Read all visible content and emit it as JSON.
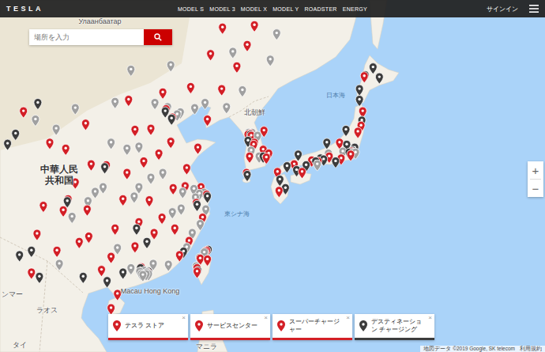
{
  "header": {
    "logo": "TESLA",
    "nav": [
      "MODEL S",
      "MODEL 3",
      "MODEL X",
      "MODEL Y",
      "ROADSTER",
      "ENERGY"
    ],
    "signin": "サインイン"
  },
  "search": {
    "placeholder": "場所を入力"
  },
  "zoom": {
    "in": "+",
    "out": "−"
  },
  "legend": [
    {
      "label": "テスラ ストア",
      "color": "#d31f26",
      "active": true,
      "close": "×"
    },
    {
      "label": "サービスセンター",
      "color": "#d31f26",
      "active": true,
      "close": "×"
    },
    {
      "label": "スーパーチャージャー",
      "color": "#d31f26",
      "active": true,
      "close": "×"
    },
    {
      "label": "デスティネーション チャージング",
      "color": "#3c3c3c",
      "active": true,
      "close": "×"
    }
  ],
  "attribution": {
    "data": "地図データ ©2019 Google, SK telecom",
    "terms": "利用規約"
  },
  "map": {
    "labels": [
      {
        "text": "Улаанбаатар",
        "lon": 108.1,
        "lat": 48.4,
        "kind": "place"
      },
      {
        "text": "中華人民共和国",
        "lon": 103.0,
        "lat": 33.9,
        "kind": "country"
      },
      {
        "text": "北朝鮮",
        "lon": 127.5,
        "lat": 40.2,
        "kind": "place"
      },
      {
        "text": "日本海",
        "lon": 137.7,
        "lat": 41.9,
        "kind": "sea"
      },
      {
        "text": "東シナ海",
        "lon": 125.3,
        "lat": 29.9,
        "kind": "sea"
      },
      {
        "text": "Macau Hong Kong",
        "lon": 114.4,
        "lat": 21.1,
        "kind": "place"
      },
      {
        "text": "ラオス",
        "lon": 101.5,
        "lat": 18.9,
        "kind": "place"
      },
      {
        "text": "ンマー",
        "lon": 97.1,
        "lat": 20.7,
        "kind": "place"
      },
      {
        "text": "タイ",
        "lon": 98.0,
        "lat": 14.7,
        "kind": "place"
      },
      {
        "text": "マニラ",
        "lon": 121.5,
        "lat": 14.5,
        "kind": "place"
      }
    ],
    "pins": [
      {
        "lon": 116.4,
        "lat": 39.9,
        "color": "#d31f26"
      },
      {
        "lon": 117.2,
        "lat": 39.1,
        "color": "#d31f26"
      },
      {
        "lon": 121.5,
        "lat": 31.2,
        "color": "#d31f26"
      },
      {
        "lon": 120.2,
        "lat": 30.3,
        "color": "#d31f26"
      },
      {
        "lon": 118.8,
        "lat": 32.1,
        "color": "#d31f26"
      },
      {
        "lon": 114.3,
        "lat": 30.6,
        "color": "#d31f26"
      },
      {
        "lon": 113.0,
        "lat": 28.2,
        "color": "#d31f26"
      },
      {
        "lon": 113.3,
        "lat": 23.1,
        "color": "#d31f26"
      },
      {
        "lon": 114.1,
        "lat": 22.5,
        "color": "#d31f26"
      },
      {
        "lon": 118.1,
        "lat": 24.5,
        "color": "#d31f26"
      },
      {
        "lon": 119.3,
        "lat": 26.1,
        "color": "#d31f26"
      },
      {
        "lon": 104.1,
        "lat": 30.7,
        "color": "#d31f26"
      },
      {
        "lon": 106.5,
        "lat": 29.6,
        "color": "#d31f26"
      },
      {
        "lon": 108.9,
        "lat": 34.3,
        "color": "#d31f26"
      },
      {
        "lon": 113.6,
        "lat": 34.7,
        "color": "#d31f26"
      },
      {
        "lon": 117.0,
        "lat": 36.7,
        "color": "#d31f26"
      },
      {
        "lon": 120.4,
        "lat": 36.1,
        "color": "#d31f26"
      },
      {
        "lon": 123.4,
        "lat": 41.8,
        "color": "#d31f26"
      },
      {
        "lon": 121.6,
        "lat": 38.9,
        "color": "#d31f26"
      },
      {
        "lon": 126.6,
        "lat": 45.8,
        "color": "#d31f26"
      },
      {
        "lon": 125.3,
        "lat": 43.9,
        "color": "#d31f26"
      },
      {
        "lon": 111.7,
        "lat": 40.8,
        "color": "#d31f26"
      },
      {
        "lon": 112.5,
        "lat": 37.9,
        "color": "#d31f26"
      },
      {
        "lon": 114.5,
        "lat": 38.0,
        "color": "#d31f26"
      },
      {
        "lon": 117.3,
        "lat": 31.9,
        "color": "#d31f26"
      },
      {
        "lon": 115.9,
        "lat": 28.7,
        "color": "#d31f26"
      },
      {
        "lon": 102.7,
        "lat": 25.0,
        "color": "#d31f26"
      },
      {
        "lon": 106.7,
        "lat": 26.6,
        "color": "#d31f26"
      },
      {
        "lon": 108.3,
        "lat": 22.8,
        "color": "#d31f26"
      },
      {
        "lon": 110.3,
        "lat": 20.0,
        "color": "#d31f26"
      },
      {
        "lon": 103.8,
        "lat": 36.0,
        "color": "#d31f26"
      },
      {
        "lon": 101.8,
        "lat": 36.6,
        "color": "#d31f26"
      },
      {
        "lon": 106.3,
        "lat": 38.5,
        "color": "#d31f26"
      },
      {
        "lon": 98.5,
        "lat": 39.7,
        "color": "#d31f26"
      },
      {
        "lon": 109.5,
        "lat": 18.3,
        "color": "#d31f26"
      },
      {
        "lon": 100.2,
        "lat": 26.9,
        "color": "#d31f26"
      },
      {
        "lon": 105.0,
        "lat": 32.5,
        "color": "#d31f26"
      },
      {
        "lon": 110.0,
        "lat": 27.5,
        "color": "#d31f26"
      },
      {
        "lon": 111.5,
        "lat": 33.5,
        "color": "#d31f26"
      },
      {
        "lon": 119.5,
        "lat": 42.0,
        "color": "#d31f26"
      },
      {
        "lon": 116.0,
        "lat": 41.5,
        "color": "#d31f26"
      },
      {
        "lon": 122.0,
        "lat": 45.0,
        "color": "#d31f26"
      },
      {
        "lon": 127.5,
        "lat": 47.5,
        "color": "#d31f26"
      },
      {
        "lon": 123.5,
        "lat": 47.3,
        "color": "#d31f26"
      },
      {
        "lon": 114.9,
        "lat": 27.0,
        "color": "#d31f26"
      },
      {
        "lon": 112.5,
        "lat": 25.5,
        "color": "#d31f26"
      },
      {
        "lon": 109.5,
        "lat": 24.3,
        "color": "#d31f26"
      },
      {
        "lon": 99.5,
        "lat": 22.5,
        "color": "#d31f26"
      },
      {
        "lon": 101.0,
        "lat": 30.0,
        "color": "#d31f26"
      },
      {
        "lon": 115.5,
        "lat": 35.5,
        "color": "#d31f26"
      },
      {
        "lon": 119.0,
        "lat": 34.0,
        "color": "#d31f26"
      },
      {
        "lon": 120.8,
        "lat": 32.0,
        "color": "#d31f26"
      },
      {
        "lon": 111.0,
        "lat": 30.7,
        "color": "#d31f26"
      },
      {
        "lon": 107.0,
        "lat": 34.4,
        "color": "#d31f26"
      },
      {
        "lon": 103.5,
        "lat": 29.5,
        "color": "#d31f26"
      },
      {
        "lon": 105.5,
        "lat": 26.0,
        "color": "#d31f26"
      },
      {
        "lon": 117.5,
        "lat": 27.5,
        "color": "#d31f26"
      },
      {
        "lon": 121.0,
        "lat": 28.7,
        "color": "#d31f26"
      },
      {
        "lon": 116.6,
        "lat": 40.1,
        "color": "#a0a0a0"
      },
      {
        "lon": 117.8,
        "lat": 39.4,
        "color": "#a0a0a0"
      },
      {
        "lon": 121.2,
        "lat": 31.4,
        "color": "#a0a0a0"
      },
      {
        "lon": 120.6,
        "lat": 31.3,
        "color": "#a0a0a0"
      },
      {
        "lon": 119.9,
        "lat": 31.8,
        "color": "#a0a0a0"
      },
      {
        "lon": 118.5,
        "lat": 31.5,
        "color": "#a0a0a0"
      },
      {
        "lon": 113.7,
        "lat": 22.7,
        "color": "#a0a0a0"
      },
      {
        "lon": 113.5,
        "lat": 22.2,
        "color": "#a0a0a0"
      },
      {
        "lon": 112.0,
        "lat": 23.0,
        "color": "#a0a0a0"
      },
      {
        "lon": 114.8,
        "lat": 23.5,
        "color": "#a0a0a0"
      },
      {
        "lon": 116.7,
        "lat": 23.4,
        "color": "#a0a0a0"
      },
      {
        "lon": 119.0,
        "lat": 25.4,
        "color": "#a0a0a0"
      },
      {
        "lon": 120.7,
        "lat": 28.0,
        "color": "#a0a0a0"
      },
      {
        "lon": 121.4,
        "lat": 29.6,
        "color": "#a0a0a0"
      },
      {
        "lon": 120.1,
        "lat": 30.9,
        "color": "#a0a0a0"
      },
      {
        "lon": 116.0,
        "lat": 33.5,
        "color": "#a0a0a0"
      },
      {
        "lon": 114.5,
        "lat": 33.0,
        "color": "#a0a0a0"
      },
      {
        "lon": 112.4,
        "lat": 31.0,
        "color": "#a0a0a0"
      },
      {
        "lon": 110.3,
        "lat": 25.3,
        "color": "#a0a0a0"
      },
      {
        "lon": 106.6,
        "lat": 30.5,
        "color": "#a0a0a0"
      },
      {
        "lon": 104.6,
        "lat": 28.8,
        "color": "#a0a0a0"
      },
      {
        "lon": 103.0,
        "lat": 23.5,
        "color": "#a0a0a0"
      },
      {
        "lon": 107.5,
        "lat": 31.5,
        "color": "#a0a0a0"
      },
      {
        "lon": 109.5,
        "lat": 36.6,
        "color": "#a0a0a0"
      },
      {
        "lon": 111.5,
        "lat": 36.0,
        "color": "#a0a0a0"
      },
      {
        "lon": 113.0,
        "lat": 36.2,
        "color": "#a0a0a0"
      },
      {
        "lon": 115.0,
        "lat": 40.5,
        "color": "#a0a0a0"
      },
      {
        "lon": 118.2,
        "lat": 39.6,
        "color": "#a0a0a0"
      },
      {
        "lon": 121.3,
        "lat": 40.5,
        "color": "#a0a0a0"
      },
      {
        "lon": 124.0,
        "lat": 40.1,
        "color": "#a0a0a0"
      },
      {
        "lon": 126.0,
        "lat": 41.7,
        "color": "#a0a0a0"
      },
      {
        "lon": 129.5,
        "lat": 44.5,
        "color": "#a0a0a0"
      },
      {
        "lon": 130.3,
        "lat": 46.8,
        "color": "#a0a0a0"
      },
      {
        "lon": 124.8,
        "lat": 45.2,
        "color": "#a0a0a0"
      },
      {
        "lon": 120.0,
        "lat": 40.0,
        "color": "#a0a0a0"
      },
      {
        "lon": 117.0,
        "lat": 44.0,
        "color": "#a0a0a0"
      },
      {
        "lon": 112.0,
        "lat": 43.6,
        "color": "#a0a0a0"
      },
      {
        "lon": 110.0,
        "lat": 40.6,
        "color": "#a0a0a0"
      },
      {
        "lon": 105.0,
        "lat": 40.0,
        "color": "#a0a0a0"
      },
      {
        "lon": 102.6,
        "lat": 38.0,
        "color": "#a0a0a0"
      },
      {
        "lon": 100.0,
        "lat": 38.9,
        "color": "#a0a0a0"
      },
      {
        "lon": 108.5,
        "lat": 32.0,
        "color": "#a0a0a0"
      },
      {
        "lon": 113.0,
        "lat": 32.0,
        "color": "#a0a0a0"
      },
      {
        "lon": 117.2,
        "lat": 29.3,
        "color": "#a0a0a0"
      },
      {
        "lon": 118.3,
        "lat": 29.7,
        "color": "#a0a0a0"
      },
      {
        "lon": 119.7,
        "lat": 27.0,
        "color": "#a0a0a0"
      },
      {
        "lon": 114.2,
        "lat": 22.3,
        "color": "#a0a0a0"
      },
      {
        "lon": 113.9,
        "lat": 22.3,
        "color": "#a0a0a0"
      },
      {
        "lon": 114.0,
        "lat": 22.5,
        "color": "#a0a0a0"
      },
      {
        "lon": 113.1,
        "lat": 22.6,
        "color": "#a0a0a0"
      },
      {
        "lon": 113.3,
        "lat": 22.3,
        "color": "#a0a0a0"
      },
      {
        "lon": 116.3,
        "lat": 39.7,
        "color": "#3c3c3c"
      },
      {
        "lon": 121.6,
        "lat": 31.0,
        "color": "#3c3c3c"
      },
      {
        "lon": 120.3,
        "lat": 30.1,
        "color": "#3c3c3c"
      },
      {
        "lon": 113.2,
        "lat": 23.0,
        "color": "#3c3c3c"
      },
      {
        "lon": 114.2,
        "lat": 22.6,
        "color": "#3c3c3c"
      },
      {
        "lon": 104.0,
        "lat": 30.5,
        "color": "#3c3c3c"
      },
      {
        "lon": 108.7,
        "lat": 34.1,
        "color": "#3c3c3c"
      },
      {
        "lon": 117.1,
        "lat": 39.0,
        "color": "#3c3c3c"
      },
      {
        "lon": 118.6,
        "lat": 24.9,
        "color": "#3c3c3c"
      },
      {
        "lon": 106.0,
        "lat": 22.0,
        "color": "#3c3c3c"
      },
      {
        "lon": 109.0,
        "lat": 21.5,
        "color": "#3c3c3c"
      },
      {
        "lon": 98.0,
        "lat": 24.5,
        "color": "#3c3c3c"
      },
      {
        "lon": 100.5,
        "lat": 22.0,
        "color": "#3c3c3c"
      },
      {
        "lon": 96.5,
        "lat": 36.5,
        "color": "#3c3c3c"
      },
      {
        "lon": 97.5,
        "lat": 37.5,
        "color": "#3c3c3c"
      },
      {
        "lon": 99.5,
        "lat": 25.0,
        "color": "#3c3c3c"
      },
      {
        "lon": 100.3,
        "lat": 40.5,
        "color": "#3c3c3c"
      },
      {
        "lon": 112.7,
        "lat": 27.5,
        "color": "#3c3c3c"
      },
      {
        "lon": 114.0,
        "lat": 26.0,
        "color": "#3c3c3c"
      },
      {
        "lon": 111.0,
        "lat": 22.5,
        "color": "#3c3c3c"
      },
      {
        "lon": 121.5,
        "lat": 25.0,
        "color": "#d31f26"
      },
      {
        "lon": 121.3,
        "lat": 24.9,
        "color": "#d31f26"
      },
      {
        "lon": 120.7,
        "lat": 24.1,
        "color": "#d31f26"
      },
      {
        "lon": 120.3,
        "lat": 23.0,
        "color": "#d31f26"
      },
      {
        "lon": 120.3,
        "lat": 22.6,
        "color": "#d31f26"
      },
      {
        "lon": 121.6,
        "lat": 24.0,
        "color": "#d31f26"
      },
      {
        "lon": 121.2,
        "lat": 24.8,
        "color": "#a0a0a0"
      },
      {
        "lon": 120.6,
        "lat": 24.2,
        "color": "#a0a0a0"
      },
      {
        "lon": 120.2,
        "lat": 23.2,
        "color": "#a0a0a0"
      },
      {
        "lon": 121.7,
        "lat": 25.1,
        "color": "#3c3c3c"
      },
      {
        "lon": 120.4,
        "lat": 22.7,
        "color": "#3c3c3c"
      },
      {
        "lon": 127.0,
        "lat": 37.5,
        "color": "#d31f26"
      },
      {
        "lon": 126.7,
        "lat": 37.4,
        "color": "#d31f26"
      },
      {
        "lon": 127.1,
        "lat": 37.3,
        "color": "#d31f26"
      },
      {
        "lon": 129.0,
        "lat": 35.1,
        "color": "#d31f26"
      },
      {
        "lon": 128.6,
        "lat": 35.9,
        "color": "#d31f26"
      },
      {
        "lon": 126.9,
        "lat": 35.2,
        "color": "#d31f26"
      },
      {
        "lon": 127.4,
        "lat": 36.4,
        "color": "#d31f26"
      },
      {
        "lon": 126.5,
        "lat": 33.5,
        "color": "#d31f26"
      },
      {
        "lon": 128.7,
        "lat": 37.8,
        "color": "#d31f26"
      },
      {
        "lon": 127.5,
        "lat": 36.6,
        "color": "#d31f26"
      },
      {
        "lon": 129.3,
        "lat": 35.5,
        "color": "#d31f26"
      },
      {
        "lon": 127.2,
        "lat": 37.6,
        "color": "#a0a0a0"
      },
      {
        "lon": 126.8,
        "lat": 37.6,
        "color": "#a0a0a0"
      },
      {
        "lon": 128.1,
        "lat": 35.2,
        "color": "#a0a0a0"
      },
      {
        "lon": 127.1,
        "lat": 35.8,
        "color": "#a0a0a0"
      },
      {
        "lon": 127.9,
        "lat": 37.3,
        "color": "#a0a0a0"
      },
      {
        "lon": 127.0,
        "lat": 37.4,
        "color": "#3c3c3c"
      },
      {
        "lon": 126.6,
        "lat": 33.3,
        "color": "#3c3c3c"
      },
      {
        "lon": 128.6,
        "lat": 35.2,
        "color": "#3c3c3c"
      },
      {
        "lon": 126.7,
        "lat": 36.8,
        "color": "#3c3c3c"
      },
      {
        "lon": 139.7,
        "lat": 35.7,
        "color": "#d31f26"
      },
      {
        "lon": 139.6,
        "lat": 35.4,
        "color": "#d31f26"
      },
      {
        "lon": 136.9,
        "lat": 35.2,
        "color": "#d31f26"
      },
      {
        "lon": 135.5,
        "lat": 34.7,
        "color": "#d31f26"
      },
      {
        "lon": 132.5,
        "lat": 34.4,
        "color": "#d31f26"
      },
      {
        "lon": 130.4,
        "lat": 33.6,
        "color": "#d31f26"
      },
      {
        "lon": 140.9,
        "lat": 38.3,
        "color": "#d31f26"
      },
      {
        "lon": 138.4,
        "lat": 35.0,
        "color": "#d31f26"
      },
      {
        "lon": 141.3,
        "lat": 43.0,
        "color": "#d31f26"
      },
      {
        "lon": 133.5,
        "lat": 33.6,
        "color": "#d31f26"
      },
      {
        "lon": 138.2,
        "lat": 36.6,
        "color": "#d31f26"
      },
      {
        "lon": 134.7,
        "lat": 34.8,
        "color": "#d31f26"
      },
      {
        "lon": 141.1,
        "lat": 39.7,
        "color": "#d31f26"
      },
      {
        "lon": 140.5,
        "lat": 37.7,
        "color": "#d31f26"
      },
      {
        "lon": 130.6,
        "lat": 31.6,
        "color": "#d31f26"
      },
      {
        "lon": 139.8,
        "lat": 35.8,
        "color": "#3c3c3c"
      },
      {
        "lon": 139.4,
        "lat": 35.6,
        "color": "#3c3c3c"
      },
      {
        "lon": 135.8,
        "lat": 35.0,
        "color": "#3c3c3c"
      },
      {
        "lon": 135.2,
        "lat": 34.7,
        "color": "#3c3c3c"
      },
      {
        "lon": 137.7,
        "lat": 34.7,
        "color": "#3c3c3c"
      },
      {
        "lon": 136.6,
        "lat": 36.6,
        "color": "#3c3c3c"
      },
      {
        "lon": 139.0,
        "lat": 37.9,
        "color": "#3c3c3c"
      },
      {
        "lon": 140.1,
        "lat": 36.1,
        "color": "#3c3c3c"
      },
      {
        "lon": 131.6,
        "lat": 34.2,
        "color": "#3c3c3c"
      },
      {
        "lon": 130.7,
        "lat": 32.8,
        "color": "#3c3c3c"
      },
      {
        "lon": 132.8,
        "lat": 33.8,
        "color": "#3c3c3c"
      },
      {
        "lon": 134.0,
        "lat": 34.3,
        "color": "#3c3c3c"
      },
      {
        "lon": 140.7,
        "lat": 40.8,
        "color": "#3c3c3c"
      },
      {
        "lon": 140.7,
        "lat": 41.8,
        "color": "#3c3c3c"
      },
      {
        "lon": 141.4,
        "lat": 43.1,
        "color": "#3c3c3c"
      },
      {
        "lon": 143.2,
        "lat": 42.9,
        "color": "#3c3c3c"
      },
      {
        "lon": 142.4,
        "lat": 43.8,
        "color": "#3c3c3c"
      },
      {
        "lon": 141.0,
        "lat": 38.8,
        "color": "#3c3c3c"
      },
      {
        "lon": 139.1,
        "lat": 36.4,
        "color": "#3c3c3c"
      },
      {
        "lon": 136.2,
        "lat": 34.9,
        "color": "#3c3c3c"
      },
      {
        "lon": 133.0,
        "lat": 35.4,
        "color": "#3c3c3c"
      },
      {
        "lon": 131.4,
        "lat": 31.9,
        "color": "#3c3c3c"
      },
      {
        "lon": 139.9,
        "lat": 35.6,
        "color": "#a0a0a0"
      },
      {
        "lon": 136.8,
        "lat": 35.5,
        "color": "#a0a0a0"
      },
      {
        "lon": 135.4,
        "lat": 34.4,
        "color": "#a0a0a0"
      },
      {
        "lon": 140.2,
        "lat": 35.6,
        "color": "#a0a0a0"
      },
      {
        "lon": 138.6,
        "lat": 35.7,
        "color": "#a0a0a0"
      }
    ]
  }
}
